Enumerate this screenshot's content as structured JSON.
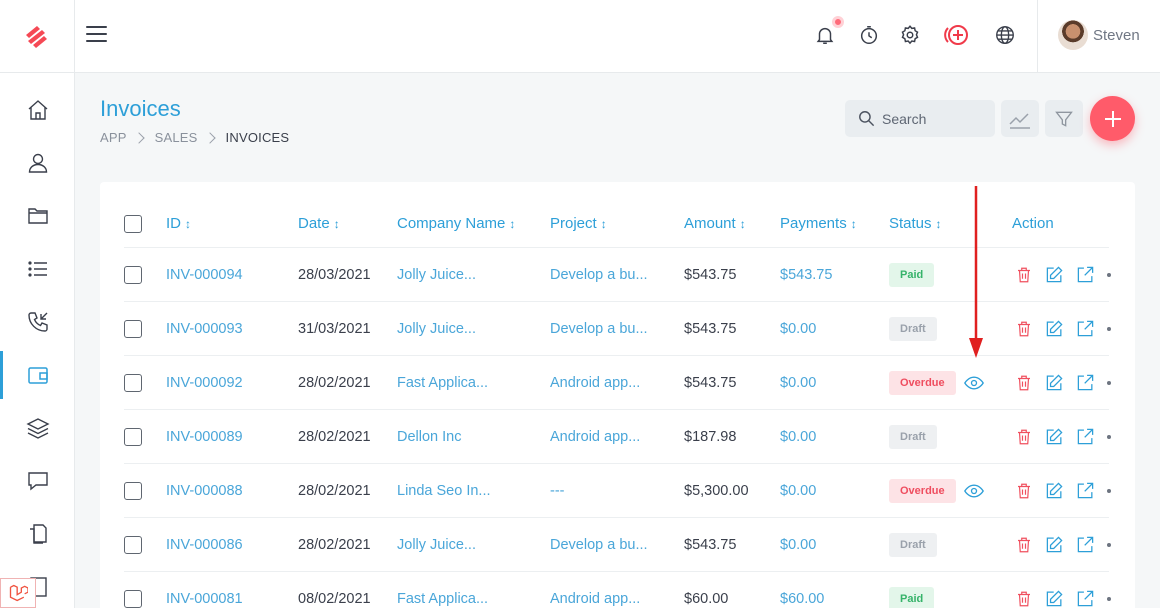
{
  "user": {
    "name": "Steven"
  },
  "page": {
    "title": "Invoices",
    "breadcrumb": [
      "APP",
      "SALES",
      "INVOICES"
    ]
  },
  "toolbar": {
    "search_placeholder": "Search"
  },
  "table": {
    "columns": [
      "ID",
      "Date",
      "Company Name",
      "Project",
      "Amount",
      "Payments",
      "Status",
      "Action"
    ],
    "rows": [
      {
        "id": "INV-000094",
        "date": "28/03/2021",
        "company": "Jolly Juice...",
        "project": "Develop a bu...",
        "amount": "$543.75",
        "payments": "$543.75",
        "status": "Paid",
        "status_type": "paid",
        "view": false
      },
      {
        "id": "INV-000093",
        "date": "31/03/2021",
        "company": "Jolly Juice...",
        "project": "Develop a bu...",
        "amount": "$543.75",
        "payments": "$0.00",
        "status": "Draft",
        "status_type": "draft",
        "view": false
      },
      {
        "id": "INV-000092",
        "date": "28/02/2021",
        "company": "Fast Applica...",
        "project": "Android app...",
        "amount": "$543.75",
        "payments": "$0.00",
        "status": "Overdue",
        "status_type": "overdue",
        "view": true
      },
      {
        "id": "INV-000089",
        "date": "28/02/2021",
        "company": "Dellon Inc",
        "project": "Android app...",
        "amount": "$187.98",
        "payments": "$0.00",
        "status": "Draft",
        "status_type": "draft",
        "view": false
      },
      {
        "id": "INV-000088",
        "date": "28/02/2021",
        "company": "Linda Seo In...",
        "project": "---",
        "amount": "$5,300.00",
        "payments": "$0.00",
        "status": "Overdue",
        "status_type": "overdue",
        "view": true
      },
      {
        "id": "INV-000086",
        "date": "28/02/2021",
        "company": "Jolly Juice...",
        "project": "Develop a bu...",
        "amount": "$543.75",
        "payments": "$0.00",
        "status": "Draft",
        "status_type": "draft",
        "view": false
      },
      {
        "id": "INV-000081",
        "date": "08/02/2021",
        "company": "Fast Applica...",
        "project": "Android app...",
        "amount": "$60.00",
        "payments": "$60.00",
        "status": "Paid",
        "status_type": "paid",
        "view": false
      }
    ]
  },
  "colors": {
    "accent": "#2d9fd8",
    "brand": "#ff5b6a",
    "annotation_arrow": "#e02020"
  }
}
